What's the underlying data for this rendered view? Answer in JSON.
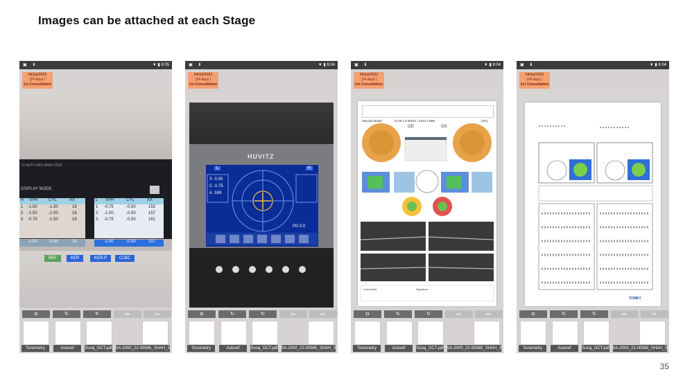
{
  "slide": {
    "title": "Images can be attached at each Stage",
    "page_number": "35"
  },
  "badge": {
    "date": "04/Jul/2022",
    "days": "(24 days )",
    "stage": "1st Consultation"
  },
  "status_times": [
    "6:05",
    "6:04",
    "6:04",
    "6:04"
  ],
  "attachments": [
    "Tonometry",
    "Autoref",
    "Suraj_OCT.pdf",
    "0A-2000_22-00565_SHAH_SUR"
  ],
  "lensometer": {
    "mode_label": "DISPLAY MODE",
    "right_headers": [
      "R",
      "SPH",
      "CYL",
      "AX"
    ],
    "right_rows": [
      [
        "1",
        "-1.50",
        "-1.50",
        "19"
      ],
      [
        "2",
        "-1.50",
        "-1.00",
        "18"
      ],
      [
        "3",
        "-0.75",
        "-1.50",
        "18"
      ]
    ],
    "left_headers": [
      "L",
      "SPH",
      "CYL",
      "AX"
    ],
    "left_rows": [
      [
        "1",
        "-0.75",
        "-0.50",
        "153"
      ],
      [
        "2",
        "-1.00",
        "-0.50",
        "157"
      ],
      [
        "3",
        "-0.75",
        "-0.50",
        "161"
      ]
    ],
    "right_footer": [
      "-1.00",
      "-1.55",
      "18"
    ],
    "left_footer": [
      "-1.00",
      "-0.50",
      "157"
    ],
    "buttons": [
      "REF",
      "KER",
      "KER-P",
      "CLBC"
    ]
  },
  "autoref": {
    "brand": "HUVITZ",
    "left_eye": "L",
    "right_eye": "R",
    "readings": [
      [
        "S",
        "-0.50"
      ],
      [
        "C",
        "-0.75"
      ],
      [
        "A",
        "169"
      ]
    ],
    "pd": "PD",
    "pd_value": "0.0"
  },
  "oct": {
    "scan": "Macular Blade",
    "dims": "12.00 x 9.00mm / A512 x B96",
    "eye_od": "OD",
    "eye_os": "OS",
    "side": "(OU)",
    "comments": "Comments",
    "signature": "Signature"
  },
  "report": {
    "brand": "TOMEY"
  },
  "toolbar_icons": [
    "camera-icon",
    "rotate-icon",
    "rotate-icon",
    "forward-icon",
    "forward-icon"
  ]
}
